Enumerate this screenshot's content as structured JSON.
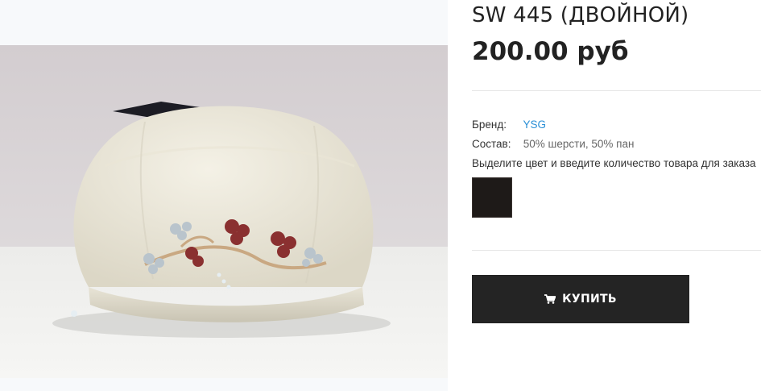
{
  "product": {
    "title": "SW 445 (ДВОЙНОЙ)",
    "price": "200.00 руб",
    "image_icon": "beret-photo"
  },
  "specs": {
    "brand_label": "Бренд:",
    "brand_value": "YSG",
    "composition_label": "Состав:",
    "composition_value": "50% шерсти, 50% пан"
  },
  "order_hint": "Выделите цвет и введите количество товара для заказа",
  "swatches": [
    {
      "color": "#1e1a18"
    }
  ],
  "buy_button": {
    "label": "КУПИТЬ",
    "icon": "cart-icon"
  }
}
